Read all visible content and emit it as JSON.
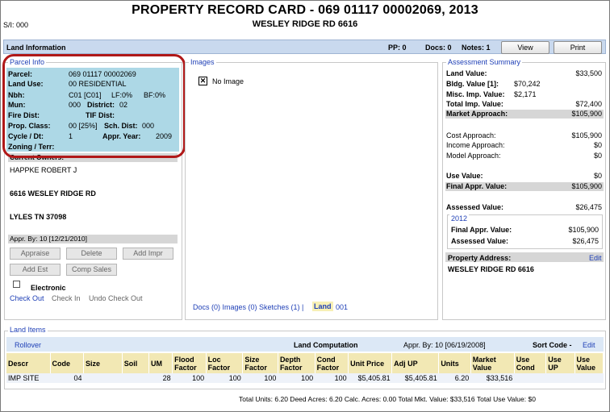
{
  "header": {
    "title": "PROPERTY RECORD CARD - 069 01117 00002069, 2013",
    "subtitle": "WESLEY RIDGE RD 6616",
    "si": "S/I: 000"
  },
  "land_bar": {
    "title": "Land Information",
    "pp": "PP: 0",
    "docs": "Docs: 0",
    "notes": "Notes: 1",
    "view_label": "View",
    "print_label": "Print"
  },
  "parcel": {
    "legend": "Parcel Info",
    "parcel_label": "Parcel:",
    "parcel_value": "069 01117 00002069",
    "land_use_label": "Land Use:",
    "land_use_value": "00 RESIDENTIAL",
    "nbh_label": "Nbh:",
    "nbh_value": "C01 [C01]",
    "lf_label": "LF:0%",
    "bf_label": "BF:0%",
    "mun_label": "Mun:",
    "mun_value": "000",
    "district_label": "District:",
    "district_value": "02",
    "fire_label": "Fire Dist:",
    "tif_label": "TIF Dist:",
    "prop_class_label": "Prop. Class:",
    "prop_class_value": "00 [25%]",
    "sch_label": "Sch. Dist:",
    "sch_value": "000",
    "cycle_label": "Cycle / Dt:",
    "cycle_value": "1",
    "appr_year_label": "Appr. Year:",
    "appr_year_value": "2009",
    "zoning_label": "Zoning / Terr:"
  },
  "owner": {
    "header": "Current Owners:",
    "name": "HAPPKE ROBERT J",
    "addr1": "6616 WESLEY RIDGE RD",
    "addr2": "LYLES TN 37098",
    "appr_by": "Appr. By: 10 [12/21/2010]"
  },
  "actions": {
    "appraise": "Appraise",
    "delete": "Delete",
    "add_impr": "Add Impr",
    "add_est": "Add Est",
    "comp_sales": "Comp Sales",
    "electronic": "Electronic",
    "check_out": "Check Out",
    "check_in": "Check In",
    "undo_check_out": "Undo Check Out"
  },
  "images": {
    "legend": "Images",
    "no_image": "No Image",
    "docs_links": "Docs (0)  Images (0)  Sketches (1)  |",
    "land": "Land",
    "land_num": "001"
  },
  "assessment": {
    "legend": "Assessment Summary",
    "land_value_label": "Land Value:",
    "land_value": "$33,500",
    "bldg_value_label": "Bldg. Value [1]:",
    "bldg_value": "$70,242",
    "misc_label": "Misc. Imp. Value:",
    "misc_value": "$2,171",
    "total_imp_label": "Total Imp. Value:",
    "total_imp_value": "$72,400",
    "market_label": "Market Approach:",
    "market_value": "$105,900",
    "cost_label": "Cost Approach:",
    "cost_value": "$105,900",
    "income_label": "Income Approach:",
    "income_value": "$0",
    "model_label": "Model Approach:",
    "model_value": "$0",
    "use_label": "Use Value:",
    "use_value": "$0",
    "final_label": "Final Appr. Value:",
    "final_value": "$105,900",
    "assessed_label": "Assessed Value:",
    "assessed_value": "$26,475",
    "y2012_legend": "2012",
    "y2012_final_label": "Final Appr. Value:",
    "y2012_final_value": "$105,900",
    "y2012_assessed_label": "Assessed Value:",
    "y2012_assessed_value": "$26,475",
    "prop_address_label": "Property Address:",
    "prop_address_edit": "Edit",
    "prop_address_value": "WESLEY RIDGE RD 6616"
  },
  "land_items": {
    "legend": "Land Items",
    "rollover": "Rollover",
    "computation_title": "Land Computation",
    "appr_by": "Appr. By: 10 [06/19/2008]",
    "sort_code": "Sort Code -",
    "edit": "Edit",
    "columns": [
      "Descr",
      "Code",
      "Size",
      "Soil",
      "UM",
      "Flood Factor",
      "Loc Factor",
      "Size Factor",
      "Depth Factor",
      "Cond Factor",
      "Unit Price",
      "Adj UP",
      "Units",
      "Market Value",
      "Use Cond",
      "Use UP",
      "Use Value"
    ],
    "rows": [
      [
        "IMP SITE",
        "04",
        "",
        "",
        "28",
        "100",
        "100",
        "100",
        "100",
        "100",
        "$5,405.81",
        "$5,405.81",
        "6.20",
        "$33,516",
        "",
        "",
        ""
      ]
    ],
    "totals": "Total Units: 6.20      Deed Acres: 6.20      Calc. Acres: 0.00      Total Mkt. Value: $33,516      Total Use Value: $0"
  }
}
